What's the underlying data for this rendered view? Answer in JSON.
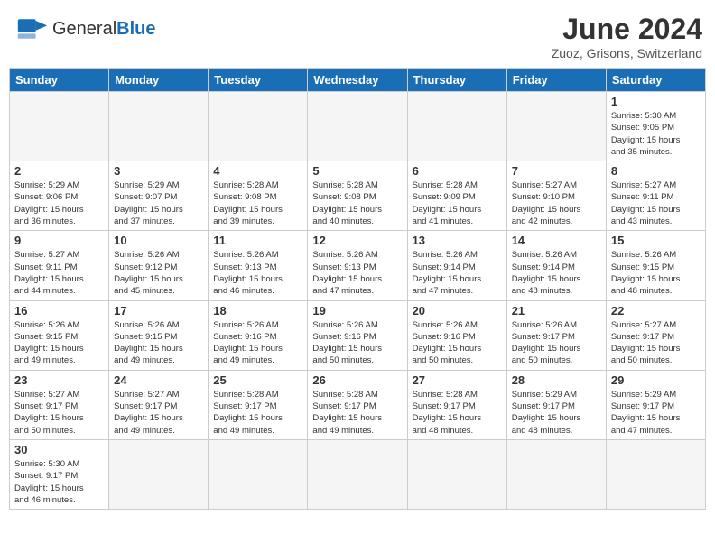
{
  "header": {
    "logo_general": "General",
    "logo_blue": "Blue",
    "month_year": "June 2024",
    "location": "Zuoz, Grisons, Switzerland"
  },
  "weekdays": [
    "Sunday",
    "Monday",
    "Tuesday",
    "Wednesday",
    "Thursday",
    "Friday",
    "Saturday"
  ],
  "weeks": [
    [
      {
        "day": "",
        "info": ""
      },
      {
        "day": "",
        "info": ""
      },
      {
        "day": "",
        "info": ""
      },
      {
        "day": "",
        "info": ""
      },
      {
        "day": "",
        "info": ""
      },
      {
        "day": "",
        "info": ""
      },
      {
        "day": "1",
        "info": "Sunrise: 5:30 AM\nSunset: 9:05 PM\nDaylight: 15 hours\nand 35 minutes."
      }
    ],
    [
      {
        "day": "2",
        "info": "Sunrise: 5:29 AM\nSunset: 9:06 PM\nDaylight: 15 hours\nand 36 minutes."
      },
      {
        "day": "3",
        "info": "Sunrise: 5:29 AM\nSunset: 9:07 PM\nDaylight: 15 hours\nand 37 minutes."
      },
      {
        "day": "4",
        "info": "Sunrise: 5:28 AM\nSunset: 9:08 PM\nDaylight: 15 hours\nand 39 minutes."
      },
      {
        "day": "5",
        "info": "Sunrise: 5:28 AM\nSunset: 9:08 PM\nDaylight: 15 hours\nand 40 minutes."
      },
      {
        "day": "6",
        "info": "Sunrise: 5:28 AM\nSunset: 9:09 PM\nDaylight: 15 hours\nand 41 minutes."
      },
      {
        "day": "7",
        "info": "Sunrise: 5:27 AM\nSunset: 9:10 PM\nDaylight: 15 hours\nand 42 minutes."
      },
      {
        "day": "8",
        "info": "Sunrise: 5:27 AM\nSunset: 9:11 PM\nDaylight: 15 hours\nand 43 minutes."
      }
    ],
    [
      {
        "day": "9",
        "info": "Sunrise: 5:27 AM\nSunset: 9:11 PM\nDaylight: 15 hours\nand 44 minutes."
      },
      {
        "day": "10",
        "info": "Sunrise: 5:26 AM\nSunset: 9:12 PM\nDaylight: 15 hours\nand 45 minutes."
      },
      {
        "day": "11",
        "info": "Sunrise: 5:26 AM\nSunset: 9:13 PM\nDaylight: 15 hours\nand 46 minutes."
      },
      {
        "day": "12",
        "info": "Sunrise: 5:26 AM\nSunset: 9:13 PM\nDaylight: 15 hours\nand 47 minutes."
      },
      {
        "day": "13",
        "info": "Sunrise: 5:26 AM\nSunset: 9:14 PM\nDaylight: 15 hours\nand 47 minutes."
      },
      {
        "day": "14",
        "info": "Sunrise: 5:26 AM\nSunset: 9:14 PM\nDaylight: 15 hours\nand 48 minutes."
      },
      {
        "day": "15",
        "info": "Sunrise: 5:26 AM\nSunset: 9:15 PM\nDaylight: 15 hours\nand 48 minutes."
      }
    ],
    [
      {
        "day": "16",
        "info": "Sunrise: 5:26 AM\nSunset: 9:15 PM\nDaylight: 15 hours\nand 49 minutes."
      },
      {
        "day": "17",
        "info": "Sunrise: 5:26 AM\nSunset: 9:15 PM\nDaylight: 15 hours\nand 49 minutes."
      },
      {
        "day": "18",
        "info": "Sunrise: 5:26 AM\nSunset: 9:16 PM\nDaylight: 15 hours\nand 49 minutes."
      },
      {
        "day": "19",
        "info": "Sunrise: 5:26 AM\nSunset: 9:16 PM\nDaylight: 15 hours\nand 50 minutes."
      },
      {
        "day": "20",
        "info": "Sunrise: 5:26 AM\nSunset: 9:16 PM\nDaylight: 15 hours\nand 50 minutes."
      },
      {
        "day": "21",
        "info": "Sunrise: 5:26 AM\nSunset: 9:17 PM\nDaylight: 15 hours\nand 50 minutes."
      },
      {
        "day": "22",
        "info": "Sunrise: 5:27 AM\nSunset: 9:17 PM\nDaylight: 15 hours\nand 50 minutes."
      }
    ],
    [
      {
        "day": "23",
        "info": "Sunrise: 5:27 AM\nSunset: 9:17 PM\nDaylight: 15 hours\nand 50 minutes."
      },
      {
        "day": "24",
        "info": "Sunrise: 5:27 AM\nSunset: 9:17 PM\nDaylight: 15 hours\nand 49 minutes."
      },
      {
        "day": "25",
        "info": "Sunrise: 5:28 AM\nSunset: 9:17 PM\nDaylight: 15 hours\nand 49 minutes."
      },
      {
        "day": "26",
        "info": "Sunrise: 5:28 AM\nSunset: 9:17 PM\nDaylight: 15 hours\nand 49 minutes."
      },
      {
        "day": "27",
        "info": "Sunrise: 5:28 AM\nSunset: 9:17 PM\nDaylight: 15 hours\nand 48 minutes."
      },
      {
        "day": "28",
        "info": "Sunrise: 5:29 AM\nSunset: 9:17 PM\nDaylight: 15 hours\nand 48 minutes."
      },
      {
        "day": "29",
        "info": "Sunrise: 5:29 AM\nSunset: 9:17 PM\nDaylight: 15 hours\nand 47 minutes."
      }
    ],
    [
      {
        "day": "30",
        "info": "Sunrise: 5:30 AM\nSunset: 9:17 PM\nDaylight: 15 hours\nand 46 minutes."
      },
      {
        "day": "",
        "info": ""
      },
      {
        "day": "",
        "info": ""
      },
      {
        "day": "",
        "info": ""
      },
      {
        "day": "",
        "info": ""
      },
      {
        "day": "",
        "info": ""
      },
      {
        "day": "",
        "info": ""
      }
    ]
  ]
}
